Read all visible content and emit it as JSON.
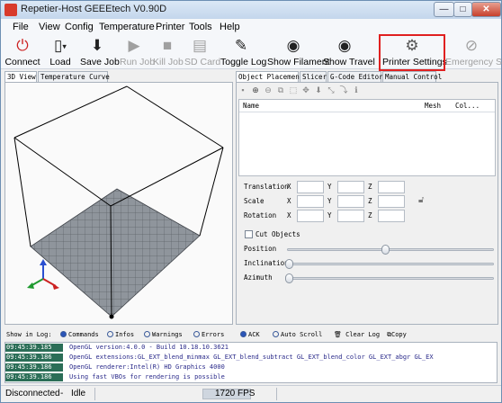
{
  "window": {
    "title": "Repetier-Host GEEEtech V0.90D",
    "minimize": "—",
    "maximize": "□",
    "close": "✕"
  },
  "menu": [
    "File",
    "View",
    "Config",
    "Temperature",
    "Printer",
    "Tools",
    "Help"
  ],
  "toolbar": [
    {
      "name": "connect",
      "label": "Connect",
      "icon": "power-icon",
      "glyph": "⏻",
      "color": "#cc2020",
      "enabled": true
    },
    {
      "name": "load",
      "label": "Load",
      "icon": "document-icon",
      "glyph": "▯",
      "color": "#222222",
      "enabled": true
    },
    {
      "name": "save-job",
      "label": "Save Job",
      "icon": "save-icon",
      "glyph": "⬇",
      "color": "#222222",
      "enabled": true
    },
    {
      "name": "run-job",
      "label": "Run Job",
      "icon": "play-icon",
      "glyph": "▶",
      "color": "#a0a0a0",
      "enabled": false
    },
    {
      "name": "kill-job",
      "label": "Kill Job",
      "icon": "stop-icon",
      "glyph": "■",
      "color": "#a0a0a0",
      "enabled": false
    },
    {
      "name": "sd-card",
      "label": "SD Card",
      "icon": "sd-card-icon",
      "glyph": "▤",
      "color": "#a0a0a0",
      "enabled": false
    },
    {
      "name": "toggle-log",
      "label": "Toggle Log",
      "icon": "pencil-icon",
      "glyph": "✎",
      "color": "#222222",
      "enabled": true
    },
    {
      "name": "show-filament",
      "label": "Show Filament",
      "icon": "eye-icon",
      "glyph": "◉",
      "color": "#222222",
      "enabled": true
    },
    {
      "name": "show-travel",
      "label": "Show Travel",
      "icon": "eye-icon",
      "glyph": "◉",
      "color": "#222222",
      "enabled": true
    },
    {
      "name": "printer-settings",
      "label": "Printer Settings",
      "icon": "gears-icon",
      "glyph": "⚙",
      "color": "#555555",
      "enabled": true
    },
    {
      "name": "emergency-stop",
      "label": "Emergency Stop",
      "icon": "emergency-stop-icon",
      "glyph": "⊘",
      "color": "#a0a0a0",
      "enabled": false
    }
  ],
  "left_tabs": [
    "3D View",
    "Temperature Curve"
  ],
  "right_tabs": [
    "Object Placement",
    "Slicer",
    "G-Code Editor",
    "Manual Control"
  ],
  "object_list": {
    "columns": [
      "Name",
      "Mesh",
      "Col..."
    ]
  },
  "transform": {
    "rows": [
      "Translation",
      "Scale",
      "Rotation"
    ],
    "axes": [
      "X",
      "Y",
      "Z"
    ]
  },
  "cut": {
    "checkbox_label": "Cut Objects",
    "sliders": [
      {
        "label": "Position",
        "value": 0.5
      },
      {
        "label": "Inclination",
        "value": 0.0
      },
      {
        "label": "Azimuth",
        "value": 0.0
      }
    ]
  },
  "log_controls": {
    "show_label": "Show in Log:",
    "commands": "Commands",
    "infos": "Infos",
    "warnings": "Warnings",
    "errors": "Errors",
    "ack": "ACK",
    "auto_scroll": "Auto Scroll",
    "clear_log": "Clear Log",
    "copy": "Copy"
  },
  "log": [
    {
      "time": "09:45:39.185",
      "msg": "OpenGL version:4.0.0 - Build 10.18.10.3621"
    },
    {
      "time": "09:45:39.186",
      "msg": "OpenGL extensions:GL_EXT_blend_minmax GL_EXT_blend_subtract GL_EXT_blend_color GL_EXT_abgr GL_EX"
    },
    {
      "time": "09:45:39.186",
      "msg": "OpenGL renderer:Intel(R) HD Graphics 4000"
    },
    {
      "time": "09:45:39.186",
      "msg": "Using fast VBOs for rendering is possible"
    }
  ],
  "status": {
    "connection": "Disconnected",
    "sep": "-",
    "state": "Idle",
    "fps": "1720 FPS"
  },
  "colors": {
    "accent": "#2b55b8",
    "highlight": "#e02020",
    "log_time_bg": "#2b6e57"
  }
}
